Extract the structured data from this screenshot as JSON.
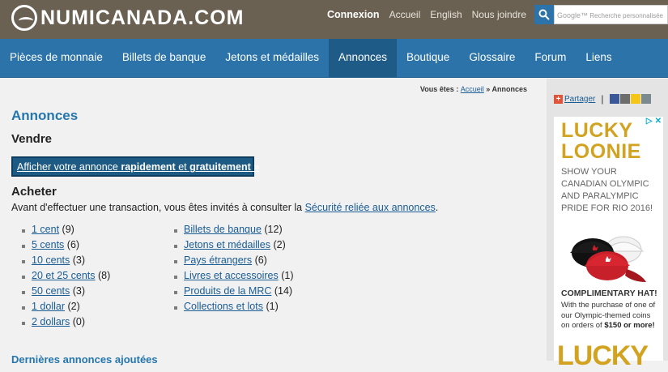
{
  "site": {
    "logo_text": "NUMICANADA.COM"
  },
  "topnav": {
    "connexion": "Connexion",
    "accueil": "Accueil",
    "english": "English",
    "nous_joindre": "Nous joindre"
  },
  "search": {
    "brand": "Google™",
    "placeholder": "Recherche personnalisée"
  },
  "mainnav": {
    "items": [
      "Pièces de monnaie",
      "Billets de banque",
      "Jetons et médailles",
      "Annonces",
      "Boutique",
      "Glossaire",
      "Forum",
      "Liens"
    ],
    "active": "Annonces"
  },
  "breadcrumb": {
    "prefix": "Vous êtes :",
    "home": "Accueil",
    "separator": "»",
    "current": "Annonces"
  },
  "page": {
    "title": "Annonces",
    "sell_heading": "Vendre",
    "cta": {
      "part1": "Afficher votre annonce ",
      "bold1": "rapidement",
      "part2": " et ",
      "bold2": "gratuitement",
      "part3": " »"
    },
    "buy_heading": "Acheter",
    "intro_text": "Avant d'effectuer une transaction, vous êtes invités à consulter la ",
    "intro_link": "Sécurité reliée aux annonces",
    "intro_end": ".",
    "bottom_heading": "Dernières annonces ajoutées"
  },
  "categories_left": [
    {
      "label": "1 cent",
      "count": "(9)"
    },
    {
      "label": "5 cents",
      "count": "(6)"
    },
    {
      "label": "10 cents",
      "count": "(3)"
    },
    {
      "label": "20 et 25 cents",
      "count": "(8)"
    },
    {
      "label": "50 cents",
      "count": "(3)"
    },
    {
      "label": "1 dollar",
      "count": "(2)"
    },
    {
      "label": "2 dollars",
      "count": "(0)"
    }
  ],
  "categories_right": [
    {
      "label": "Billets de banque",
      "count": "(12)"
    },
    {
      "label": "Jetons et médailles",
      "count": "(2)"
    },
    {
      "label": "Pays étrangers",
      "count": "(6)"
    },
    {
      "label": "Livres et accessoires",
      "count": "(1)"
    },
    {
      "label": "Produits de la MRC",
      "count": "(14)"
    },
    {
      "label": "Collections et lots",
      "count": "(1)"
    }
  ],
  "sidebar": {
    "share_label": "Partager",
    "share_separator": "|",
    "ad": {
      "heading_line1": "LUCKY",
      "heading_line2": "LOONIE",
      "text": "SHOW YOUR CANADIAN OLYMPIC AND PARALYMPIC PRIDE FOR RIO 2016!",
      "offer_title": "COMPLIMENTARY HAT!",
      "offer_text": "With the purchase of one of our Olympic-themed coins on orders of",
      "offer_amount": "$150",
      "offer_end": "or more!",
      "bottom_text": "LUCKY",
      "colors": {
        "gold": "#d2a321",
        "red": "#c8202a"
      }
    }
  },
  "colors": {
    "topbar": "#6b6152",
    "nav": "#2b73a8",
    "nav_active": "#1f5b87",
    "title": "#2576ad",
    "link": "#1a5c94"
  }
}
